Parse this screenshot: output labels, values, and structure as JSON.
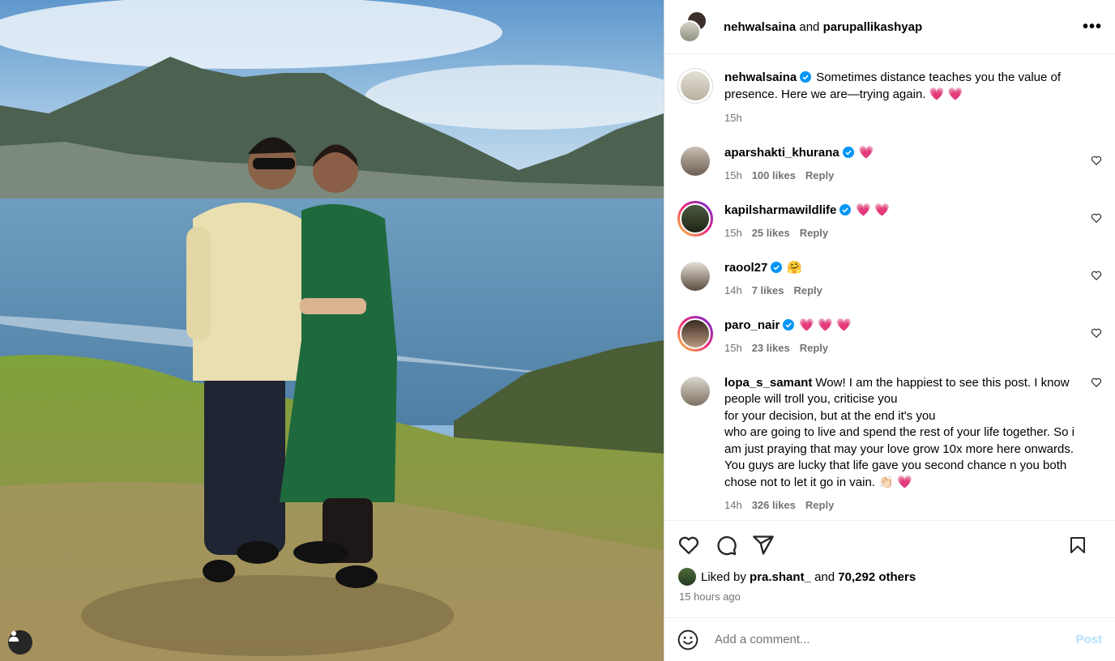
{
  "header": {
    "author": "nehwalsaina",
    "joiner": "and",
    "coauthor": "parupallikashyap",
    "more_icon": "more-horizontal-icon"
  },
  "caption": {
    "username": "nehwalsaina",
    "verified": true,
    "text": "Sometimes distance teaches you the value of presence. Here we are—trying again.",
    "emoji": "💗 💗",
    "time": "15h"
  },
  "comments": [
    {
      "username": "aparshakti_khurana",
      "verified": true,
      "text": "",
      "emoji": "💗",
      "time": "15h",
      "likes": "100 likes",
      "reply": "Reply",
      "ring": false
    },
    {
      "username": "kapilsharmawildlife",
      "verified": true,
      "text": "",
      "emoji": "💗 💗",
      "time": "15h",
      "likes": "25 likes",
      "reply": "Reply",
      "ring": true
    },
    {
      "username": "raool27",
      "verified": true,
      "text": "",
      "emoji": "🤗",
      "time": "14h",
      "likes": "7 likes",
      "reply": "Reply",
      "ring": false
    },
    {
      "username": "paro_nair",
      "verified": true,
      "text": "",
      "emoji": "💗 💗 💗",
      "time": "15h",
      "likes": "23 likes",
      "reply": "Reply",
      "ring": true
    },
    {
      "username": "lopa_s_samant",
      "verified": false,
      "text": "Wow! I am the happiest to see this post. I know people will troll you, criticise you",
      "text2": "for your decision, but at the end it's you",
      "text3": "who are going to live and spend the rest of your life together. So i am just praying that may your love grow 10x more here onwards. You guys are lucky that life gave you second chance n you both chose not to let it go in vain.",
      "emoji": "👏🏻 💗",
      "time": "14h",
      "likes": "326 likes",
      "reply": "Reply",
      "ring": false
    }
  ],
  "actions": {
    "liked_prefix": "Liked by",
    "liked_user": "pra.shant_",
    "liked_joiner": "and",
    "liked_others": "70,292 others",
    "time_ago": "15 hours ago"
  },
  "add_comment": {
    "placeholder": "Add a comment...",
    "post_label": "Post"
  },
  "colors": {
    "verified_blue": "#0095f6",
    "post_disabled": "#b2dffc",
    "heart_pink": "#ff2f6c"
  }
}
